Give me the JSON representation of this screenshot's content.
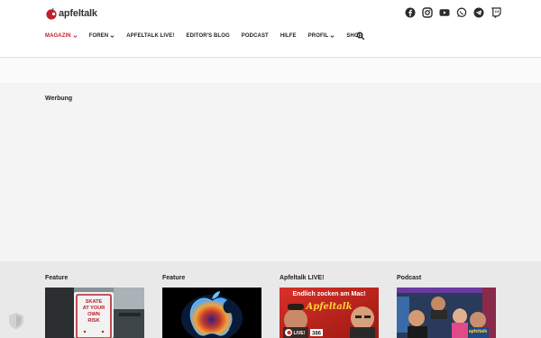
{
  "brand": {
    "name": "apfeltalk",
    "accent": "#c0202c"
  },
  "socials": [
    {
      "icon": "facebook-icon"
    },
    {
      "icon": "instagram-icon"
    },
    {
      "icon": "youtube-icon"
    },
    {
      "icon": "whatsapp-icon"
    },
    {
      "icon": "telegram-icon"
    },
    {
      "icon": "twitch-icon"
    }
  ],
  "nav": {
    "items": [
      {
        "label": "MAGAZIN",
        "active": true,
        "has_dropdown": true
      },
      {
        "label": "FOREN",
        "has_dropdown": true
      },
      {
        "label": "APFELTALK LIVE!"
      },
      {
        "label": "EDITOR'S BLOG"
      },
      {
        "label": "PODCAST"
      },
      {
        "label": "HILFE"
      },
      {
        "label": "PROFIL",
        "has_dropdown": true
      },
      {
        "label": "SHOP"
      }
    ],
    "search_icon": "search-icon"
  },
  "ad": {
    "label": "Werbung"
  },
  "features": [
    {
      "label": "Feature",
      "image": "skate-at-your-own-risk-sign"
    },
    {
      "label": "Feature",
      "image": "glowing-apple-logo"
    },
    {
      "label": "Apfeltalk LIVE!",
      "image": "apfeltalk-live-thumbnail",
      "overlay_title": "Endlich zocken am Mac!",
      "overlay_brand": "Apfeltalk",
      "badge_text": "LIVE!",
      "badge_number": "386"
    },
    {
      "label": "Podcast",
      "image": "podcast-hosts-photo",
      "overlay_brand": "apfeltalk"
    }
  ],
  "sign_text": [
    "SKATE",
    "AT YOUR",
    "OWN",
    "RISK"
  ]
}
